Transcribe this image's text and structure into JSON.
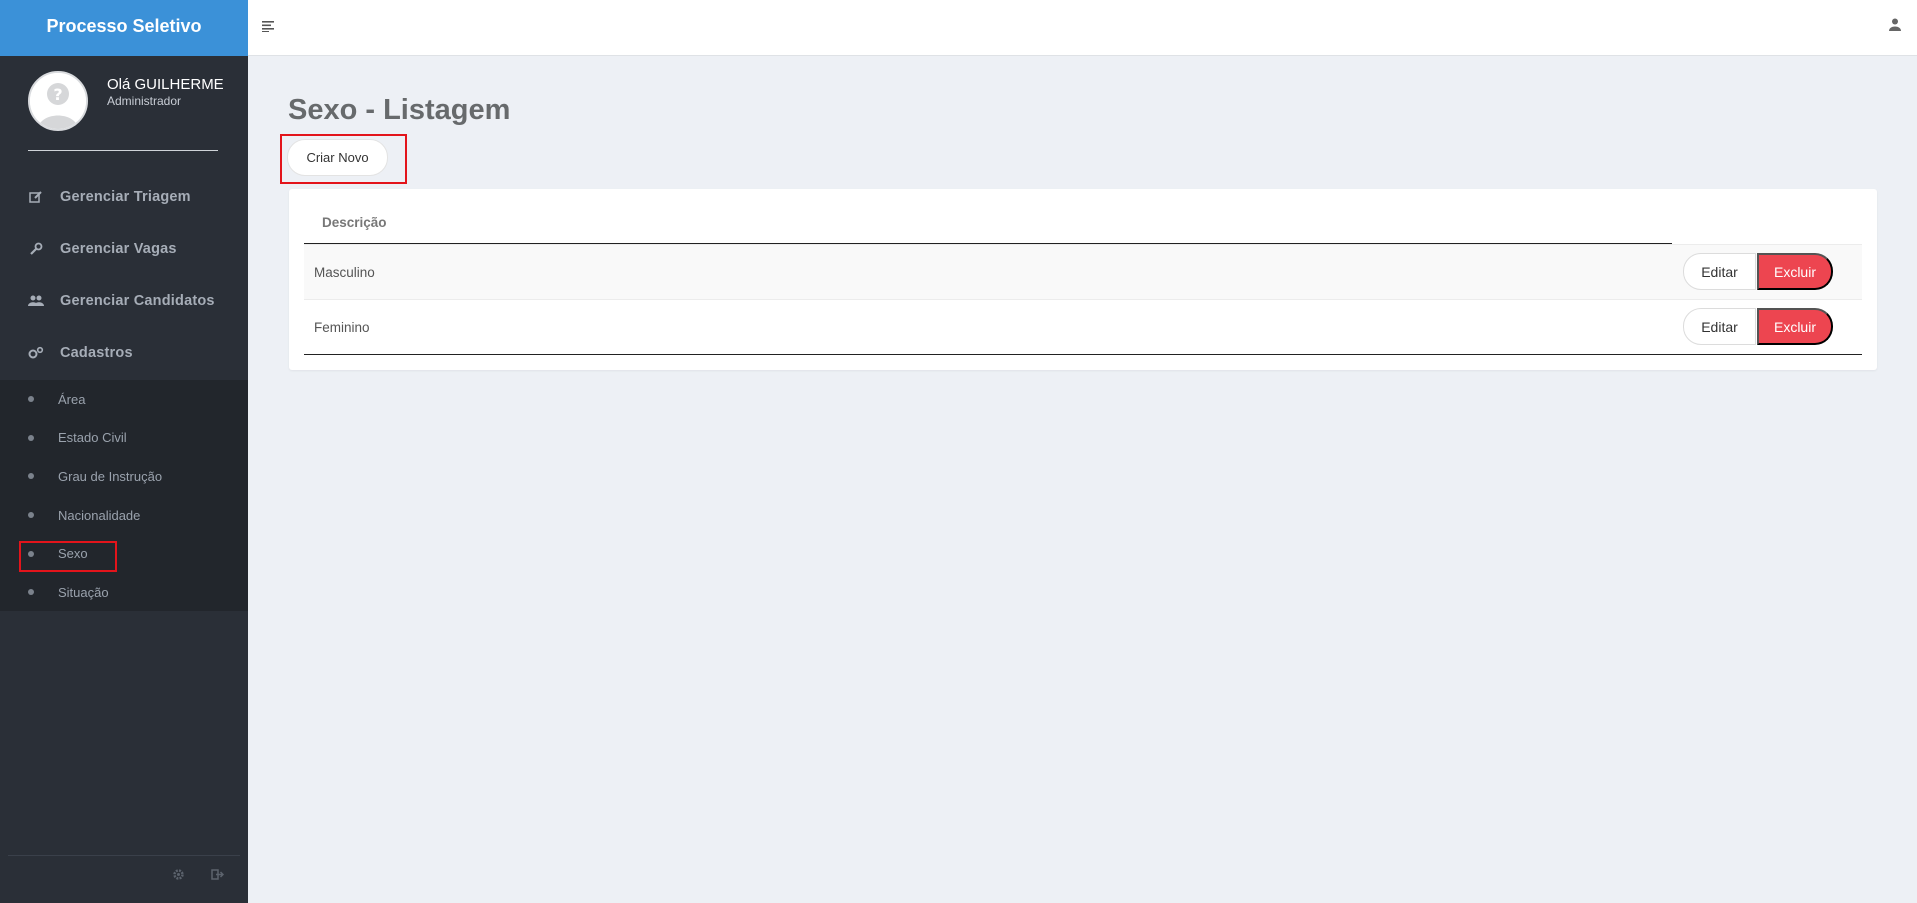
{
  "brand": {
    "title": "Processo Seletivo"
  },
  "profile": {
    "greeting": "Olá GUILHERME",
    "role": "Administrador"
  },
  "nav": {
    "items": [
      {
        "label": "Gerenciar Triagem",
        "icon": "edit-icon"
      },
      {
        "label": "Gerenciar Vagas",
        "icon": "wrench-icon"
      },
      {
        "label": "Gerenciar Candidatos",
        "icon": "users-icon"
      },
      {
        "label": "Cadastros",
        "icon": "cogs-icon"
      }
    ],
    "sub_items": [
      {
        "label": "Área"
      },
      {
        "label": "Estado Civil"
      },
      {
        "label": "Grau de Instrução"
      },
      {
        "label": "Nacionalidade"
      },
      {
        "label": "Sexo"
      },
      {
        "label": "Situação"
      }
    ]
  },
  "footer_icons": [
    "gear-icon",
    "sign-out-icon"
  ],
  "topbar": {
    "menu_icon": "menu-icon",
    "user_icon": "user-icon"
  },
  "page": {
    "title": "Sexo - Listagem",
    "create_label": "Criar Novo"
  },
  "table": {
    "header": "Descrição",
    "rows": [
      {
        "value": "Masculino",
        "edit": "Editar",
        "delete": "Excluir"
      },
      {
        "value": "Feminino",
        "edit": "Editar",
        "delete": "Excluir"
      }
    ]
  },
  "colors": {
    "brand": "#3b91d8",
    "sidebar": "#2a2f37",
    "danger": "#ed4550",
    "highlight": "#e3141b"
  }
}
